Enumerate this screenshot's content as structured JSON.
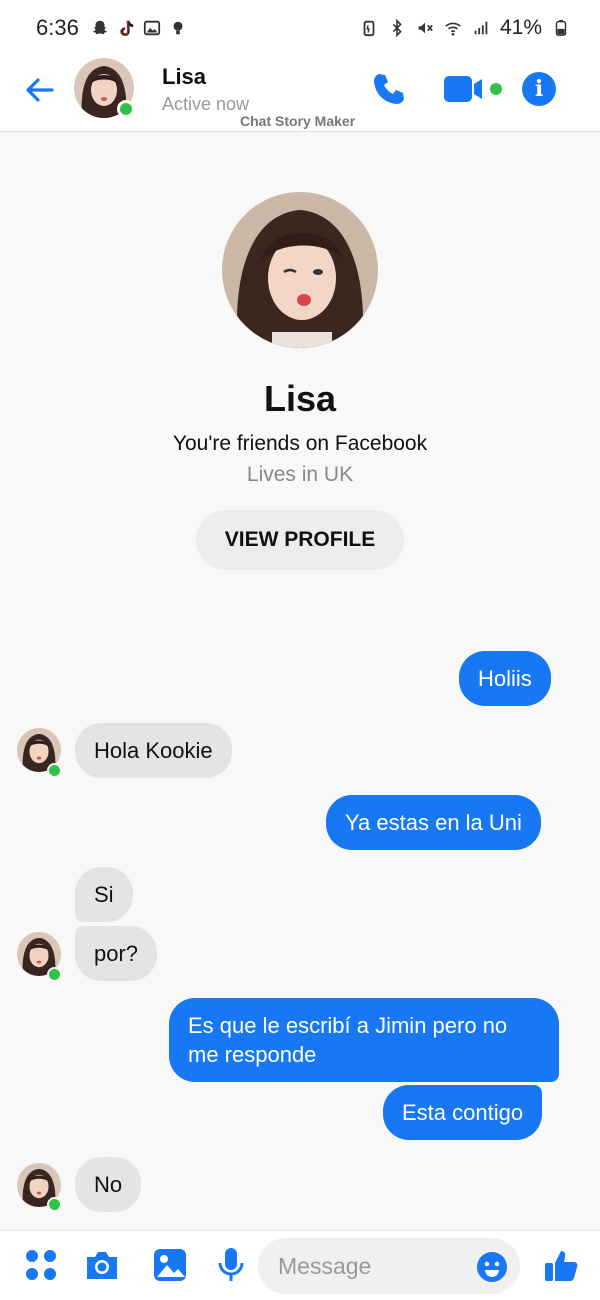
{
  "status_bar": {
    "time": "6:36",
    "battery": "41%",
    "left_icons": [
      "snapchat-icon",
      "tiktok-icon",
      "gallery-icon",
      "bulb-icon"
    ],
    "right_icons": [
      "battery-saver-icon",
      "bluetooth-icon",
      "mute-icon",
      "wifi-icon",
      "signal-icon",
      "battery-icon"
    ]
  },
  "header": {
    "name": "Lisa",
    "status": "Active now",
    "watermark": "Chat Story Maker"
  },
  "profile": {
    "name": "Lisa",
    "friends_text": "You're friends on Facebook",
    "lives_text": "Lives in UK",
    "view_profile_label": "VIEW PROFILE"
  },
  "messages": [
    {
      "side": "out",
      "text": "Holiis"
    },
    {
      "side": "in",
      "text": "Hola Kookie"
    },
    {
      "side": "out",
      "text": "Ya estas en la Uni"
    },
    {
      "side": "in",
      "text": "Si"
    },
    {
      "side": "in",
      "text": "por?"
    },
    {
      "side": "out",
      "text": "Es que le escribí a Jimin pero no me responde"
    },
    {
      "side": "out",
      "text": "Esta contigo"
    },
    {
      "side": "in",
      "text": "No"
    }
  ],
  "composer": {
    "placeholder": "Message"
  },
  "colors": {
    "accent": "#1877f2",
    "online": "#31c248",
    "incoming_bubble": "#e4e4e4"
  }
}
